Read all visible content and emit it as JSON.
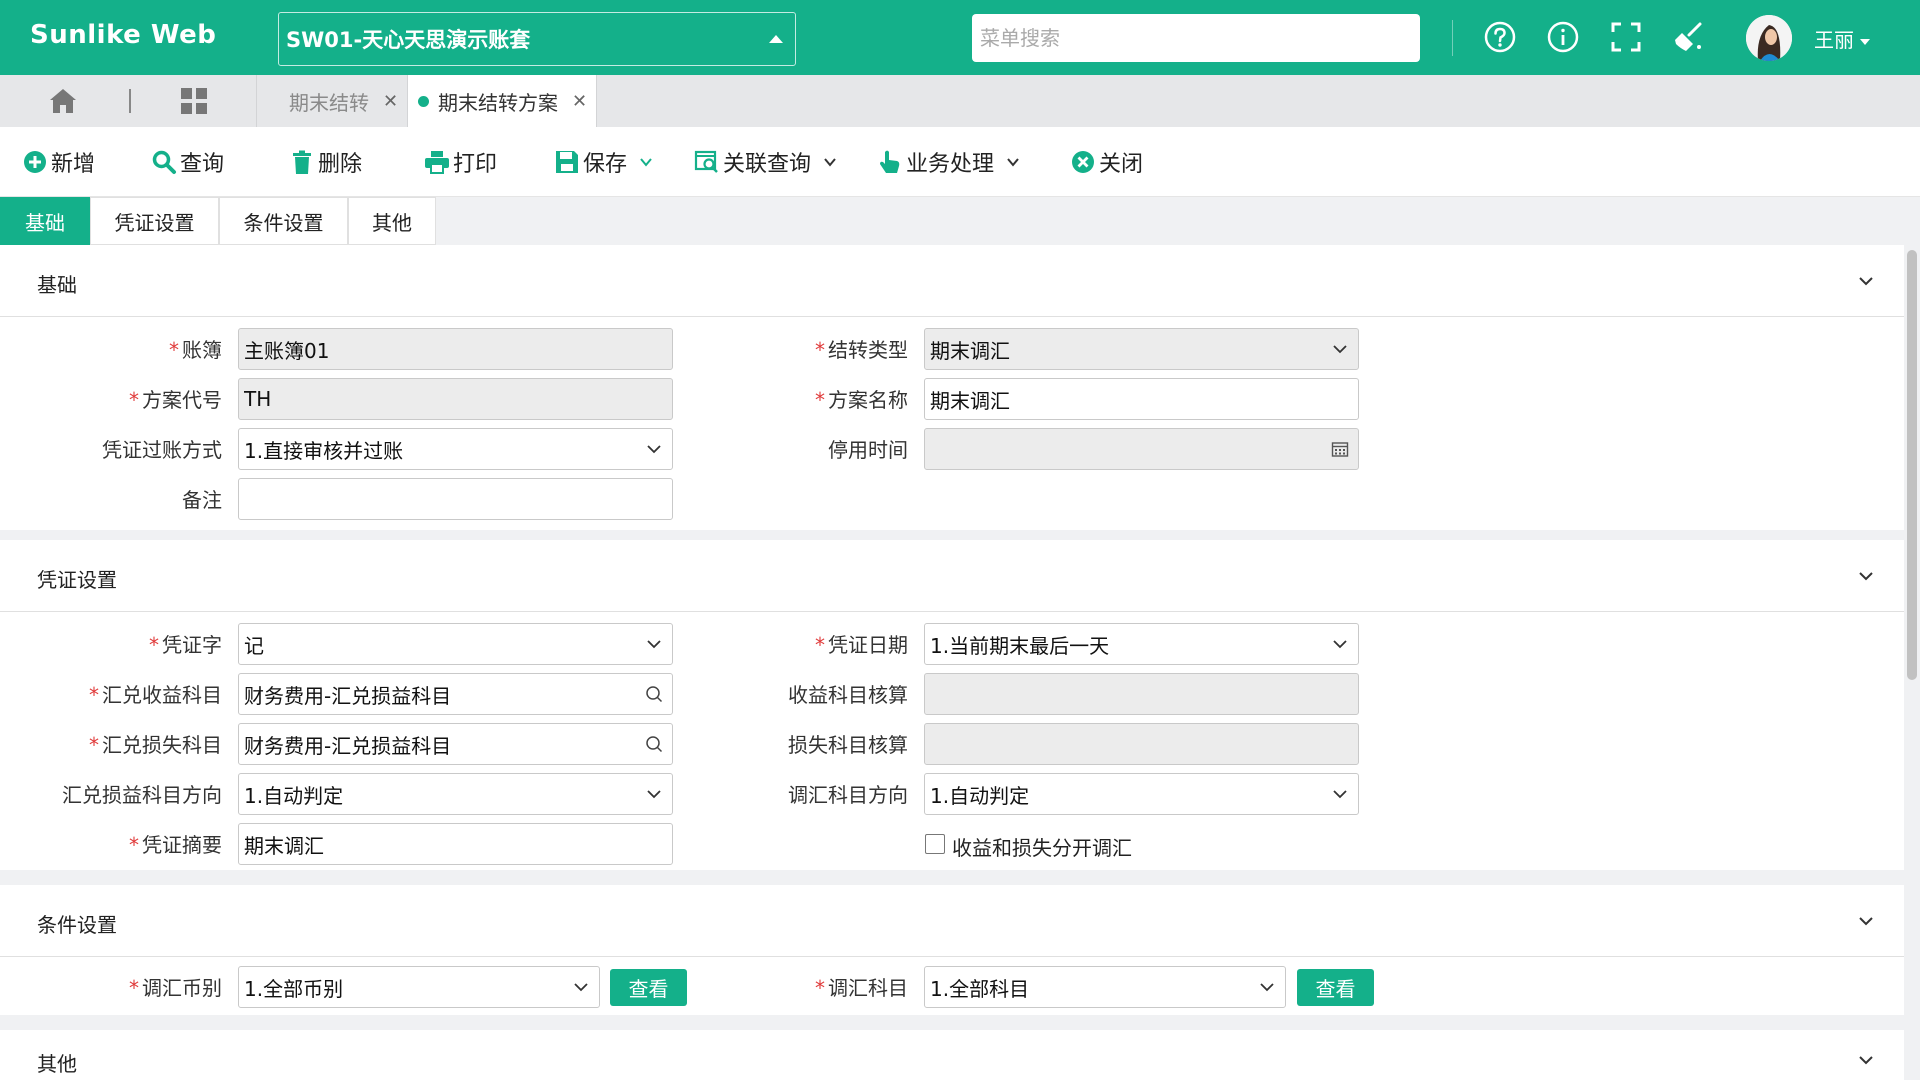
{
  "header": {
    "brand": "Sunlike Web",
    "account": "SW01-天心天思演示账套",
    "search_placeholder": "菜单搜索",
    "user_name": "王丽",
    "icons": [
      "help-icon",
      "info-icon",
      "fullscreen-icon",
      "clean-icon"
    ]
  },
  "tabbar": {
    "tabs": [
      {
        "label": "期末结转",
        "active": false
      },
      {
        "label": "期末结转方案",
        "active": true
      }
    ]
  },
  "toolbar": {
    "new": "新增",
    "query": "查询",
    "delete": "删除",
    "print": "打印",
    "save": "保存",
    "related": "关联查询",
    "business": "业务处理",
    "close": "关闭"
  },
  "section_tabs": [
    "基础",
    "凭证设置",
    "条件设置",
    "其他"
  ],
  "sections": {
    "basic": {
      "title": "基础",
      "ledger_label": "账簿",
      "ledger_value": "主账簿01",
      "transfer_type_label": "结转类型",
      "transfer_type_value": "期末调汇",
      "plan_code_label": "方案代号",
      "plan_code_value": "TH",
      "plan_name_label": "方案名称",
      "plan_name_value": "期末调汇",
      "posting_label": "凭证过账方式",
      "posting_value": "1.直接审核并过账",
      "disable_time_label": "停用时间",
      "disable_time_value": "",
      "remark_label": "备注",
      "remark_value": ""
    },
    "voucher": {
      "title": "凭证设置",
      "voucher_word_label": "凭证字",
      "voucher_word_value": "记",
      "voucher_date_label": "凭证日期",
      "voucher_date_value": "1.当前期末最后一天",
      "gain_account_label": "汇兑收益科目",
      "gain_account_value": "财务费用-汇兑损益科目",
      "gain_check_label": "收益科目核算",
      "gain_check_value": "",
      "loss_account_label": "汇兑损失科目",
      "loss_account_value": "财务费用-汇兑损益科目",
      "loss_check_label": "损失科目核算",
      "loss_check_value": "",
      "gl_direction_label": "汇兑损益科目方向",
      "gl_direction_value": "1.自动判定",
      "adj_direction_label": "调汇科目方向",
      "adj_direction_value": "1.自动判定",
      "summary_label": "凭证摘要",
      "summary_value": "期末调汇",
      "separate_label": "收益和损失分开调汇",
      "separate_checked": false
    },
    "condition": {
      "title": "条件设置",
      "currency_label": "调汇币别",
      "currency_value": "1.全部币别",
      "account_label": "调汇科目",
      "account_value": "1.全部科目",
      "view_label": "查看"
    },
    "other": {
      "title": "其他"
    }
  },
  "colors": {
    "brand": "#14b08a",
    "required": "#e03b3b"
  }
}
